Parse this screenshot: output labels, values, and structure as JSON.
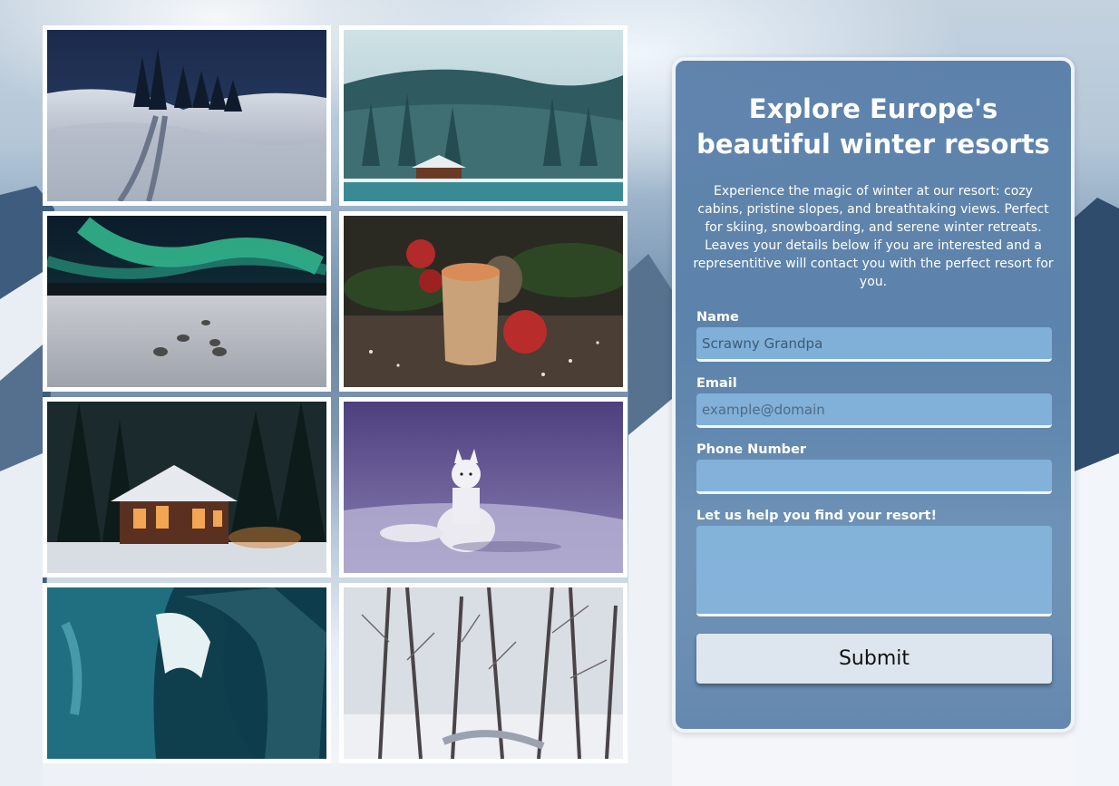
{
  "gallery": {
    "photos": [
      {
        "icon": "snowy-hills-trail-image"
      },
      {
        "icon": "lakeside-cabin-forest-image"
      },
      {
        "icon": "northern-lights-dogsled-image"
      },
      {
        "icon": "hot-drink-pinecone-image"
      },
      {
        "icon": "lit-cabin-snowy-forest-image"
      },
      {
        "icon": "arctic-fox-image"
      },
      {
        "icon": "ice-cave-image"
      },
      {
        "icon": "snowy-birch-forest-image"
      }
    ]
  },
  "form": {
    "title": "Explore Europe's beautiful winter resorts",
    "description": "Experience the magic of winter at our resort: cozy cabins, pristine slopes, and breathtaking views. Perfect for skiing, snowboarding, and serene winter retreats. Leaves your details below if you are interested and a representitive will contact you with the perfect resort for you.",
    "name_label": "Name",
    "name_value": "Scrawny Grandpa",
    "email_label": "Email",
    "email_placeholder": "example@domain",
    "phone_label": "Phone Number",
    "phone_value": "",
    "message_label": "Let us help you find your resort!",
    "message_value": "",
    "submit_label": "Submit"
  },
  "colors": {
    "panel": "#5a82ac",
    "input": "#8cbee6",
    "button": "#dde6ef"
  }
}
